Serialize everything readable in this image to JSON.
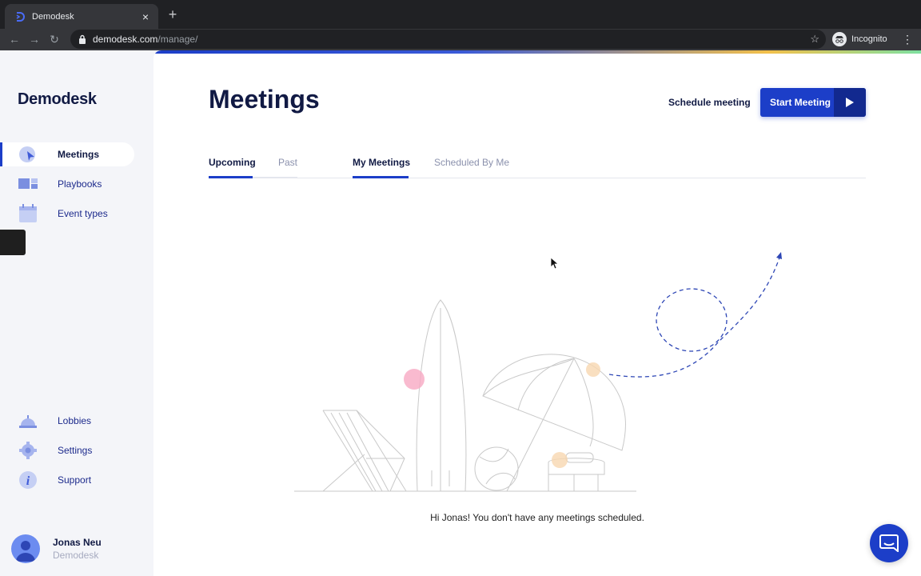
{
  "browser": {
    "tab_title": "Demodesk",
    "url_host": "demodesk.com",
    "url_path": "/manage/",
    "profile_label": "Incognito"
  },
  "sidebar": {
    "logo_text": "Demodesk",
    "items": [
      {
        "label": "Meetings",
        "icon": "meetings-icon",
        "active": true
      },
      {
        "label": "Playbooks",
        "icon": "playbooks-icon",
        "active": false
      },
      {
        "label": "Event types",
        "icon": "calendar-icon",
        "active": false
      }
    ],
    "bottom_items": [
      {
        "label": "Lobbies",
        "icon": "bell-icon"
      },
      {
        "label": "Settings",
        "icon": "gear-icon"
      },
      {
        "label": "Support",
        "icon": "info-icon"
      }
    ],
    "user": {
      "name": "Jonas Neu",
      "org": "Demodesk"
    }
  },
  "main": {
    "title": "Meetings",
    "schedule_link": "Schedule meeting",
    "start_button": "Start Meeting",
    "time_tabs": [
      {
        "label": "Upcoming",
        "active": true
      },
      {
        "label": "Past",
        "active": false
      }
    ],
    "owner_tabs": [
      {
        "label": "My Meetings",
        "active": true
      },
      {
        "label": "Scheduled By Me",
        "active": false
      }
    ],
    "empty_message": "Hi Jonas! You don't have any meetings scheduled."
  },
  "colors": {
    "accent": "#1c3ec8",
    "navy": "#111a44",
    "muted": "#8b91ad"
  }
}
